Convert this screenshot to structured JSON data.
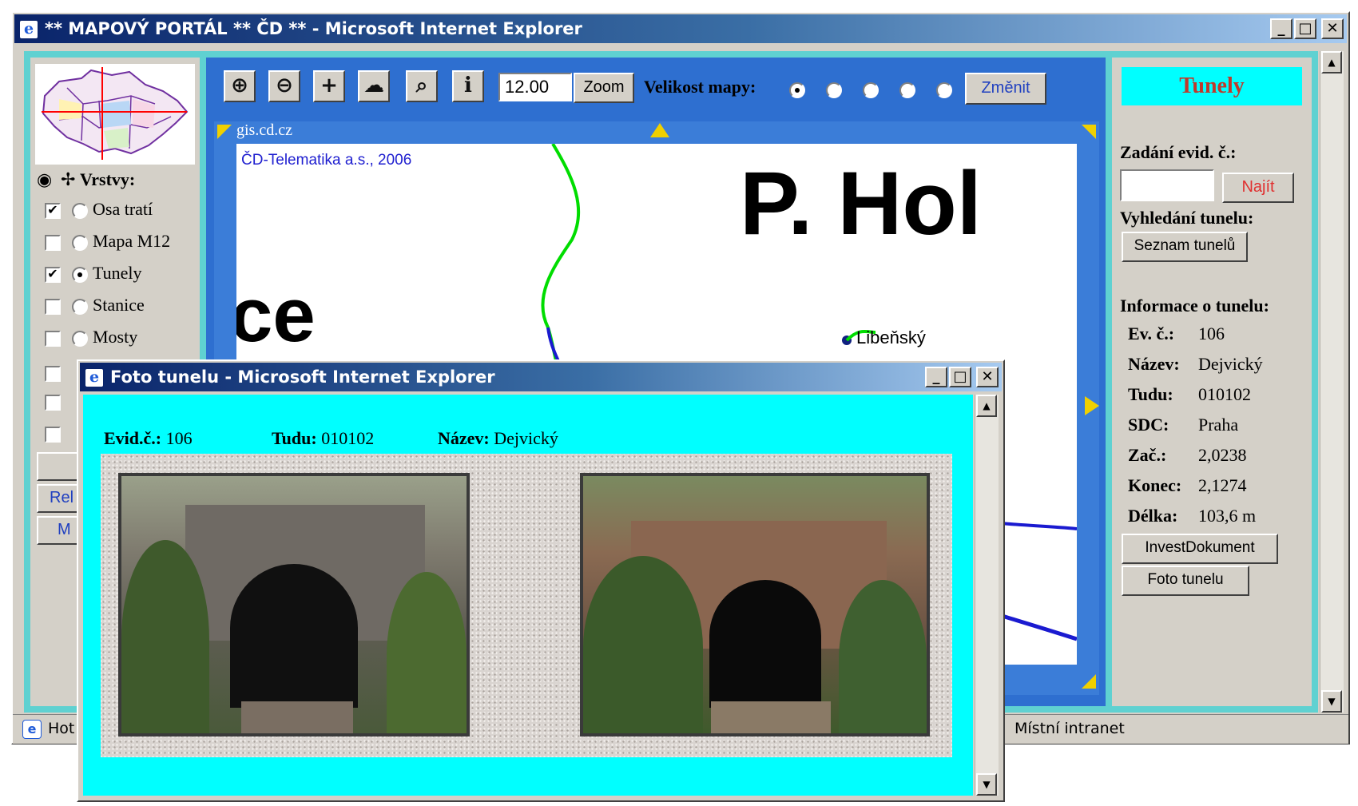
{
  "main_window": {
    "title": "** MAPOVÝ PORTÁL ** ČD ** - Microsoft Internet Explorer",
    "minimize": "_",
    "maximize": "□",
    "close": "✕",
    "status_left": "Hot",
    "status_zone": "Místní intranet"
  },
  "toolbar": {
    "zoom_in_icon": "zoom-in-icon",
    "zoom_out_icon": "zoom-out-icon",
    "pan_icon": "pan-icon",
    "full_extent_icon": "full-extent-icon",
    "zoom_box_icon": "zoom-box-icon",
    "info_icon": "info-icon",
    "zoom_value": "12.00",
    "zoom_button": "Zoom",
    "map_size_label": "Velikost mapy:",
    "map_size_selected_index": 0,
    "change_button": "Změnit"
  },
  "layers": {
    "header": "Vrstvy:",
    "items": [
      {
        "label": "Osa tratí",
        "visible": true,
        "active": false
      },
      {
        "label": "Mapa M12",
        "visible": false,
        "active": false
      },
      {
        "label": "Tunely",
        "visible": true,
        "active": true
      },
      {
        "label": "Stanice",
        "visible": false,
        "active": false
      },
      {
        "label": "Mosty",
        "visible": false,
        "active": false
      }
    ],
    "partial_buttons": [
      "Rel",
      "M"
    ]
  },
  "map": {
    "source_url": "gis.cd.cz",
    "copyright": "ČD-Telematika a.s., 2006",
    "label_big": "P. Hol",
    "label_partial": "ce",
    "station_label": "Libeňský"
  },
  "right_panel": {
    "title": "Tunely",
    "input_label": "Zadání evid. č.:",
    "input_value": "",
    "find_button": "Najít",
    "search_label": "Vyhledání tunelu:",
    "list_button": "Seznam tunelů",
    "info_header": "Informace o tunelu:",
    "info": [
      {
        "key": "Ev. č.:",
        "value": "106"
      },
      {
        "key": "Název:",
        "value": "Dejvický"
      },
      {
        "key": "Tudu:",
        "value": "010102"
      },
      {
        "key": "SDC:",
        "value": "Praha"
      },
      {
        "key": "Zač.:",
        "value": "2,0238"
      },
      {
        "key": "Konec:",
        "value": "2,1274"
      },
      {
        "key": "Délka:",
        "value": "103,6 m"
      }
    ],
    "invest_button": "InvestDokument",
    "photo_button": "Foto tunelu"
  },
  "popup": {
    "title": "Foto tunelu - Microsoft Internet Explorer",
    "evid_label": "Evid.č.:",
    "evid_value": "106",
    "tudu_label": "Tudu:",
    "tudu_value": "010102",
    "name_label": "Název:",
    "name_value": "Dejvický"
  },
  "colors": {
    "title_bar": "#0a246a",
    "frame_cyan": "#5fd1d1",
    "popup_bg": "#00ffff",
    "map_border": "#2e6fd0",
    "panel_title_bg": "#00ffff",
    "panel_title_text": "#c0392b",
    "link_blue": "#0000ff",
    "find_text": "#e03030"
  }
}
